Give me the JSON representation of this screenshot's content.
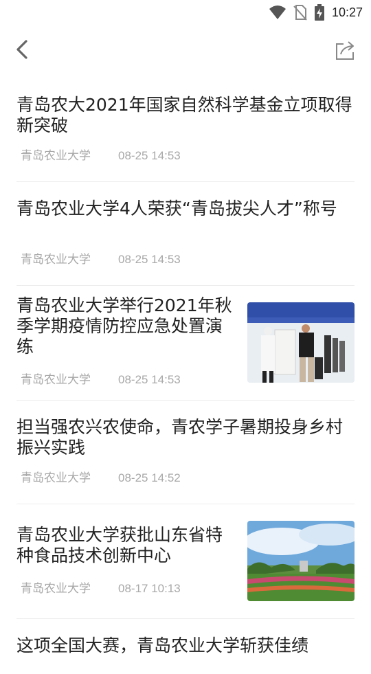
{
  "status_bar": {
    "time": "10:27",
    "icons": [
      "wifi-icon",
      "no-sim-icon",
      "battery-charging-icon"
    ]
  },
  "toolbar": {
    "back_icon": "chevron-left-icon",
    "share_icon": "share-icon"
  },
  "articles": [
    {
      "title": "青岛农大2021年国家自然科学基金立项取得新突破",
      "source": "青岛农业大学",
      "time": "08-25 14:53",
      "has_image": false
    },
    {
      "title": "青岛农业大学4人荣获“青岛拔尖人才”称号",
      "source": "青岛农业大学",
      "time": "08-25 14:53",
      "has_image": false
    },
    {
      "title": "青岛农业大学举行2021年秋季学期疫情防控应急处置演练",
      "source": "青岛农业大学",
      "time": "08-25 14:53",
      "has_image": true
    },
    {
      "title": "担当强农兴农使命，青农学子暑期投身乡村振兴实践",
      "source": "青岛农业大学",
      "time": "08-25 14:52",
      "has_image": false
    },
    {
      "title": "青岛农业大学获批山东省特种食品技术创新中心",
      "source": "青岛农业大学",
      "time": "08-17 10:13",
      "has_image": true
    },
    {
      "title": "这项全国大赛，青岛农业大学斩获佳绩",
      "source": "",
      "time": "",
      "has_image": false
    }
  ]
}
